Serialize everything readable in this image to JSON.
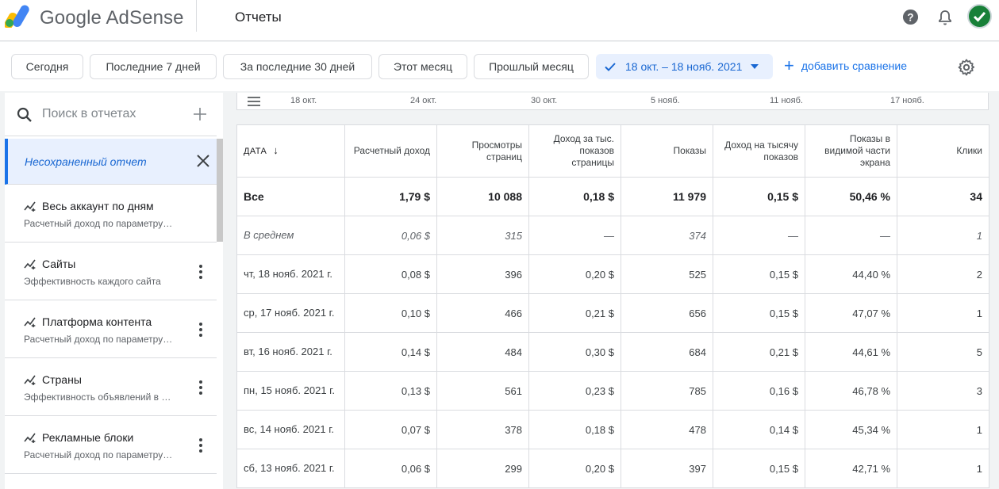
{
  "header": {
    "brand_google": "Google",
    "brand_product": "AdSense",
    "page_title": "Отчеты",
    "icons": [
      "google-adsense-logo",
      "help-icon",
      "bell-icon",
      "avatar-check"
    ]
  },
  "filters": {
    "chips": [
      "Сегодня",
      "Последние 7 дней",
      "За последние 30 дней",
      "Этот месяц",
      "Прошлый месяц"
    ],
    "date_range": "18 окт. – 18 нояб. 2021",
    "add_compare": "добавить сравнение"
  },
  "sidebar": {
    "search_placeholder": "Поиск в отчетах",
    "unsaved_label": "Несохраненный отчет",
    "items": [
      {
        "title": "Весь аккаунт по дням",
        "subtitle": "Расчетный доход по параметру \"Дата\""
      },
      {
        "title": "Сайты",
        "subtitle": "Эффективность каждого сайта"
      },
      {
        "title": "Платформа контента",
        "subtitle": "Расчетный доход по параметру \"Платформа контента\""
      },
      {
        "title": "Страны",
        "subtitle": "Эффективность объявлений в разных странах"
      },
      {
        "title": "Рекламные блоки",
        "subtitle": "Расчетный доход по параметру \"Рекламные блоки\""
      }
    ]
  },
  "timeline": {
    "ticks": [
      "18 окт.",
      "24 окт.",
      "30 окт.",
      "5 нояб.",
      "11 нояб.",
      "17 нояб."
    ]
  },
  "table": {
    "sort_column": "ДАТА",
    "columns": [
      "ДАТА",
      "Расчетный доход",
      "Просмотры страниц",
      "Доход за тыс. показов страницы",
      "Показы",
      "Доход на тысячу показов",
      "Показы в видимой части экрана",
      "Клики"
    ],
    "total": [
      "Все",
      "1,79 $",
      "10 088",
      "0,18 $",
      "11 979",
      "0,15 $",
      "50,46 %",
      "34"
    ],
    "average": [
      "В среднем",
      "0,06 $",
      "315",
      "—",
      "374",
      "—",
      "—",
      "1"
    ],
    "rows": [
      [
        "чт, 18 нояб. 2021 г.",
        "0,08 $",
        "396",
        "0,20 $",
        "525",
        "0,15 $",
        "44,40 %",
        "2"
      ],
      [
        "ср, 17 нояб. 2021 г.",
        "0,10 $",
        "466",
        "0,21 $",
        "656",
        "0,15 $",
        "47,07 %",
        "1"
      ],
      [
        "вт, 16 нояб. 2021 г.",
        "0,14 $",
        "484",
        "0,30 $",
        "684",
        "0,21 $",
        "44,61 %",
        "5"
      ],
      [
        "пн, 15 нояб. 2021 г.",
        "0,13 $",
        "561",
        "0,23 $",
        "785",
        "0,16 $",
        "46,78 %",
        "3"
      ],
      [
        "вс, 14 нояб. 2021 г.",
        "0,07 $",
        "378",
        "0,18 $",
        "478",
        "0,14 $",
        "45,34 %",
        "1"
      ],
      [
        "сб, 13 нояб. 2021 г.",
        "0,06 $",
        "299",
        "0,20 $",
        "397",
        "0,15 $",
        "42,71 %",
        "1"
      ]
    ]
  },
  "colors": {
    "accent": "#1a73e8",
    "active_chip_bg": "#e8f0fe",
    "avatar": "#188038"
  }
}
